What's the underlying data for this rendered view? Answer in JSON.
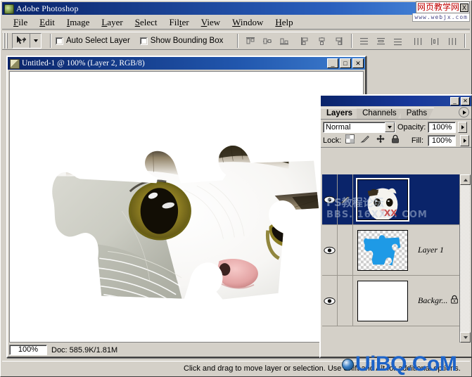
{
  "app": {
    "title": "Adobe Photoshop",
    "icon": "photoshop-app-icon"
  },
  "watermark_top": {
    "chinese": "网页教学网",
    "close_label": "X",
    "url": "www.webjx.com"
  },
  "watermark_bottom": {
    "text": "UiBQ.CoM",
    "icon": "globe-icon"
  },
  "watermark_layer": {
    "line1": "PS教程论坛",
    "line2": "BBS. 16XX8. COM",
    "red_mark": "XX"
  },
  "menubar": {
    "items": [
      {
        "label": "File",
        "mnemonic": "F"
      },
      {
        "label": "Edit",
        "mnemonic": "E"
      },
      {
        "label": "Image",
        "mnemonic": "I"
      },
      {
        "label": "Layer",
        "mnemonic": "L"
      },
      {
        "label": "Select",
        "mnemonic": "S"
      },
      {
        "label": "Filter",
        "mnemonic": "t"
      },
      {
        "label": "View",
        "mnemonic": "V"
      },
      {
        "label": "Window",
        "mnemonic": "W"
      },
      {
        "label": "Help",
        "mnemonic": "H"
      }
    ]
  },
  "options_bar": {
    "tool_icon": "move-tool-icon",
    "tool_preset_arrow": "chevron-down-icon",
    "checkboxes": [
      {
        "label": "Auto Select Layer",
        "checked": false
      },
      {
        "label": "Show Bounding Box",
        "checked": false
      }
    ],
    "align_group_1": [
      "align-top-edges-icon",
      "align-vertical-centers-icon",
      "align-bottom-edges-icon"
    ],
    "align_group_2": [
      "align-left-edges-icon",
      "align-horizontal-centers-icon",
      "align-right-edges-icon"
    ],
    "distribute_group_1": [
      "distribute-top-edges-icon",
      "distribute-vertical-centers-icon",
      "distribute-bottom-edges-icon"
    ],
    "distribute_group_2": [
      "distribute-left-edges-icon",
      "distribute-horizontal-centers-icon",
      "distribute-right-edges-icon"
    ]
  },
  "document": {
    "title": "Untitled-1 @ 100% (Layer 2, RGB/8)",
    "icon": "document-icon",
    "window_buttons": {
      "minimize": "_",
      "maximize": "□",
      "close": "✕"
    },
    "zoom": "100%",
    "doc_size": "Doc: 585.9K/1.81M",
    "play_icon": "play-triangle-icon",
    "canvas": {
      "description": "white-cat-face-clipped-to-jigsaw-puzzle-piece",
      "background": "#ffffff"
    }
  },
  "layers_panel": {
    "window_buttons": {
      "minimize": "_",
      "close": "✕"
    },
    "tabs": [
      {
        "label": "Layers",
        "active": true
      },
      {
        "label": "Channels",
        "active": false
      },
      {
        "label": "Paths",
        "active": false
      }
    ],
    "menu_icon": "palette-menu-icon",
    "blend_mode": "Normal",
    "blend_arrow_icon": "chevron-down-icon",
    "opacity_label": "Opacity:",
    "opacity_value": "100%",
    "opacity_spin_icon": "chevron-right-icon",
    "lock_label": "Lock:",
    "lock_icons": [
      "lock-transparent-pixels-icon",
      "lock-image-pixels-icon",
      "lock-position-icon",
      "lock-all-icon"
    ],
    "fill_label": "Fill:",
    "fill_value": "100%",
    "fill_spin_icon": "chevron-right-icon",
    "scrollbar": {
      "up_icon": "scroll-up-arrow-icon",
      "down_icon": "scroll-down-arrow-icon"
    },
    "layers": [
      {
        "name": "",
        "visible": true,
        "selected": true,
        "eye_icon": "eye-icon",
        "edit_icon": "paintbrush-icon",
        "thumbnail": "cat-face-thumbnail",
        "locked": false
      },
      {
        "name": "Layer 1",
        "visible": true,
        "selected": false,
        "eye_icon": "eye-icon",
        "edit_icon": "",
        "thumbnail": "blue-puzzle-piece-thumbnail",
        "locked": false
      },
      {
        "name": "Backgr...",
        "visible": true,
        "selected": false,
        "eye_icon": "eye-icon",
        "edit_icon": "",
        "thumbnail": "white-background-thumbnail",
        "locked": true,
        "lock_icon": "padlock-icon"
      }
    ]
  },
  "statusbar": {
    "hint": "Click and drag to move layer or selection. Use Shift and Alt for additional options."
  },
  "colors": {
    "window_face": "#d4d0c8",
    "title_active": "#0a246a",
    "selection": "#0a246a",
    "puzzle_blue": "#1e9ae6",
    "watermark_blue": "#1d63c8"
  }
}
